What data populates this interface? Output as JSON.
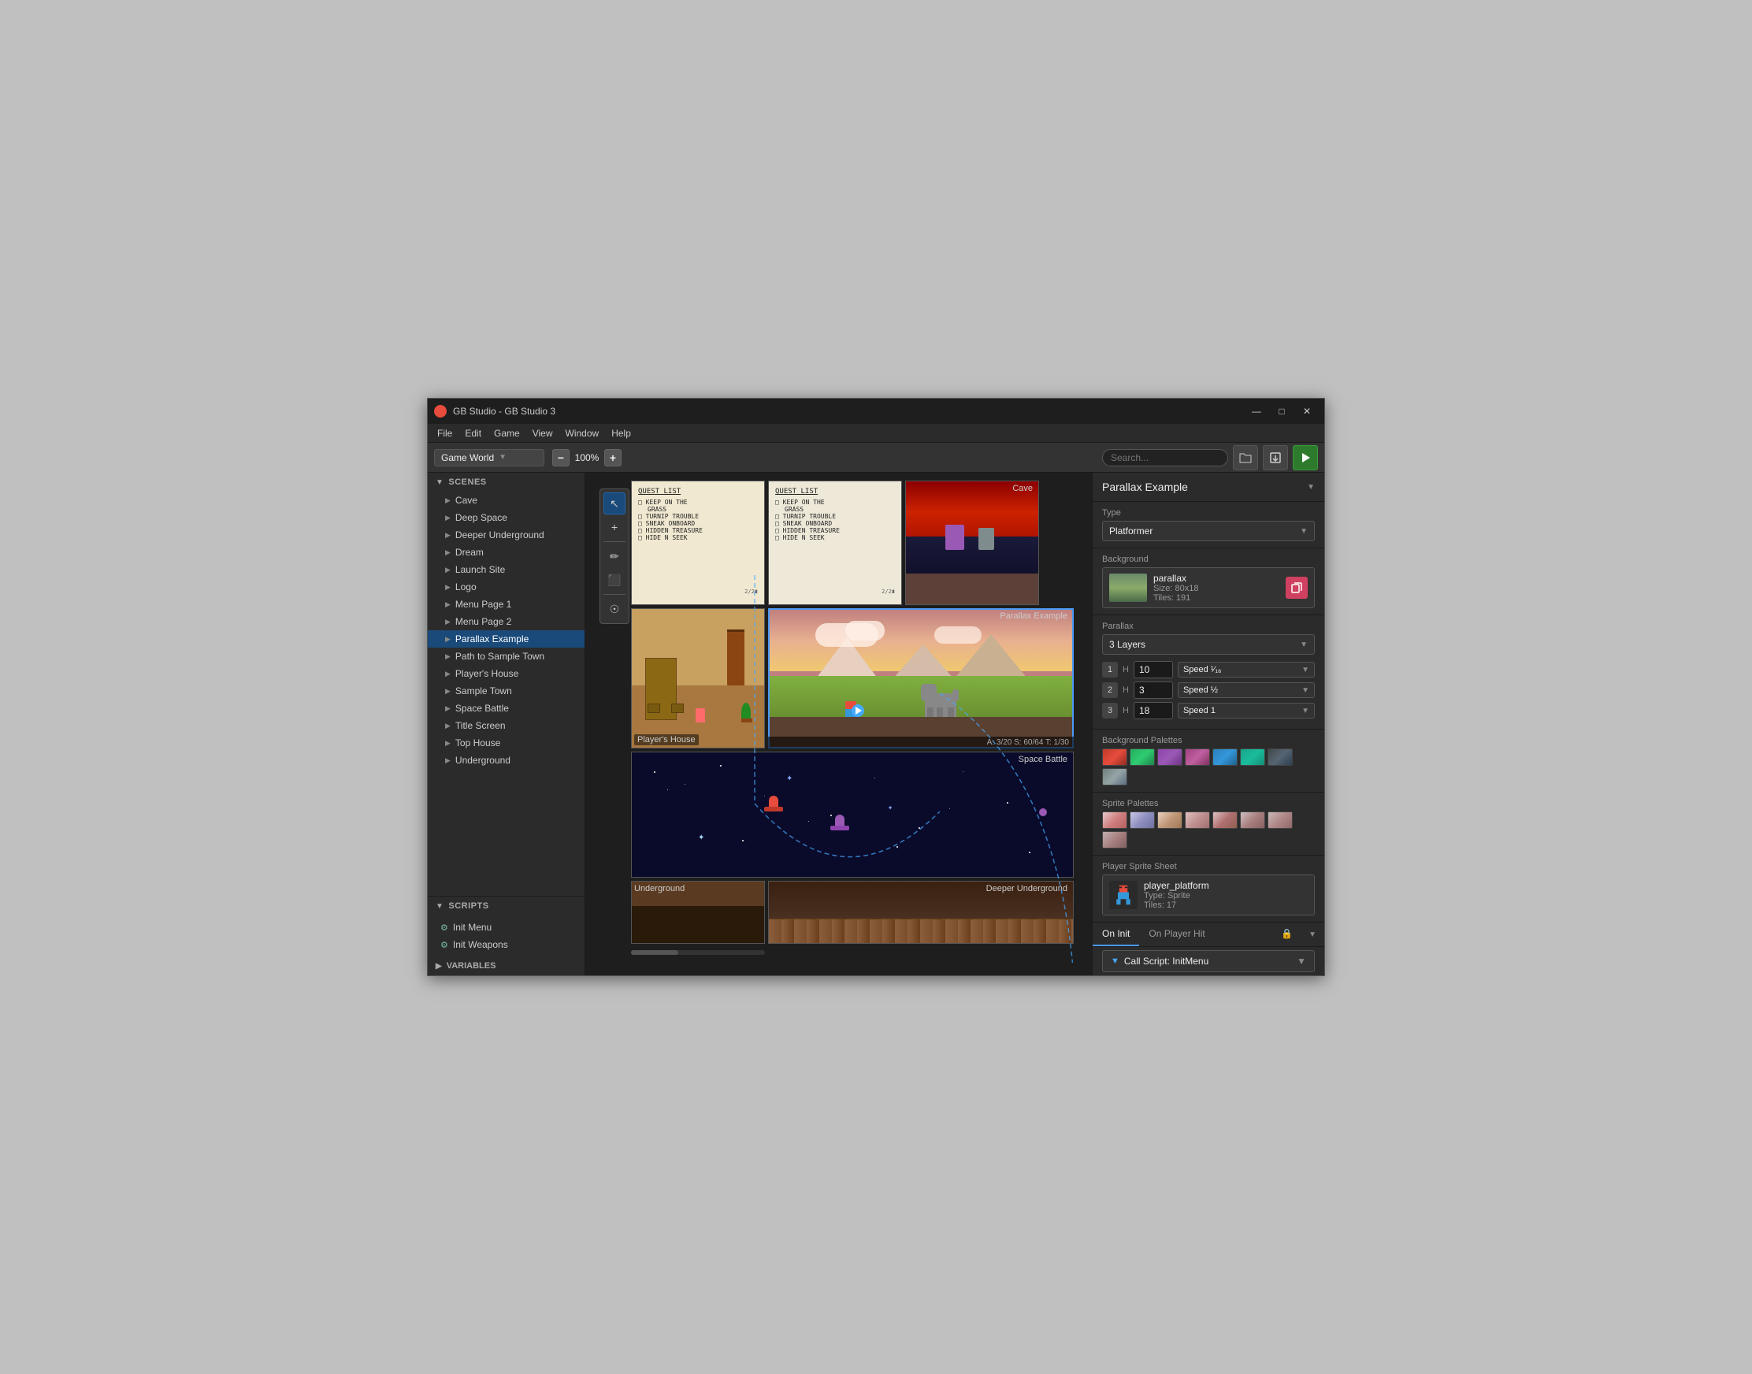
{
  "window": {
    "title": "GB Studio - GB Studio 3",
    "logo_color": "#e74c3c"
  },
  "titlebar": {
    "title": "GB Studio - GB Studio 3",
    "minimize": "—",
    "maximize": "□",
    "close": "✕"
  },
  "menubar": {
    "items": [
      "File",
      "Edit",
      "Game",
      "View",
      "Window",
      "Help"
    ]
  },
  "toolbar": {
    "world_label": "Game World",
    "zoom_value": "100%",
    "zoom_minus": "−",
    "zoom_plus": "+",
    "search_placeholder": "Search...",
    "play_label": "▶"
  },
  "sidebar": {
    "scenes_label": "SCENES",
    "scenes": [
      {
        "name": "Cave",
        "active": false
      },
      {
        "name": "Deep Space",
        "active": false
      },
      {
        "name": "Deeper Underground",
        "active": false
      },
      {
        "name": "Dream",
        "active": false
      },
      {
        "name": "Launch Site",
        "active": false
      },
      {
        "name": "Logo",
        "active": false
      },
      {
        "name": "Menu Page 1",
        "active": false
      },
      {
        "name": "Menu Page 2",
        "active": false
      },
      {
        "name": "Parallax Example",
        "active": true
      },
      {
        "name": "Path to Sample Town",
        "active": false
      },
      {
        "name": "Player's House",
        "active": false
      },
      {
        "name": "Sample Town",
        "active": false
      },
      {
        "name": "Space Battle",
        "active": false
      },
      {
        "name": "Title Screen",
        "active": false
      },
      {
        "name": "Top House",
        "active": false
      },
      {
        "name": "Underground",
        "active": false
      }
    ],
    "scripts_label": "SCRIPTS",
    "scripts": [
      {
        "name": "Init Menu"
      },
      {
        "name": "Init Weapons"
      }
    ],
    "variables_label": "VARIABLES"
  },
  "canvas": {
    "scene_labels": [
      "Player's House",
      "Parallax Example",
      "Space Battle",
      "Underground",
      "Deeper Underground"
    ],
    "cave_label": "Cave",
    "status": "A: 3/20  S: 60/64  T: 1/30"
  },
  "right_panel": {
    "title": "Parallax Example",
    "type_label": "Type",
    "type_value": "Platformer",
    "background_label": "Background",
    "bg_name": "parallax",
    "bg_size": "Size: 80x18",
    "bg_tiles": "Tiles: 191",
    "parallax_label": "Parallax",
    "parallax_value": "3 Layers",
    "layers": [
      {
        "num": "1",
        "h_label": "H",
        "value": "10",
        "speed": "Speed ¹⁄₁₆"
      },
      {
        "num": "2",
        "h_label": "H",
        "value": "3",
        "speed": "Speed ½"
      },
      {
        "num": "3",
        "h_label": "H",
        "value": "18",
        "speed": "Speed 1"
      }
    ],
    "bg_palettes_label": "Background Palettes",
    "sprite_palettes_label": "Sprite Palettes",
    "player_sprite_label": "Player Sprite Sheet",
    "sprite_name": "player_platform",
    "sprite_type": "Type: Sprite",
    "sprite_tiles": "Tiles: 17",
    "tabs": [
      "On Init",
      "On Player Hit"
    ],
    "active_tab": "On Init",
    "script_event": "▼ Call Script: InitMenu",
    "lock_icon": "🔒"
  },
  "tools": {
    "items": [
      "↖",
      "+",
      "✏",
      "⬛",
      "☉"
    ]
  }
}
